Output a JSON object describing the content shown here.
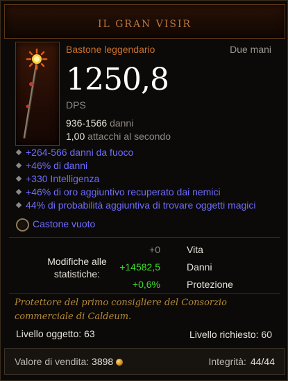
{
  "item": {
    "name": "IL GRAN VISIR",
    "type": "Bastone leggendario",
    "slot": "Due mani",
    "dps_value": "1250,8",
    "dps_label": "DPS",
    "damage_range": "936-1566",
    "damage_label": "danni",
    "attack_speed": "1,00",
    "attack_speed_label": "attacchi al secondo",
    "affixes": [
      "+264-566 danni da fuoco",
      "+46% di danni",
      "+330 Intelligenza",
      "+46% di oro aggiuntivo recuperato dai nemici",
      "44% di probabilità aggiuntiva di trovare oggetti magici"
    ],
    "socket_label": "Castone vuoto",
    "stat_changes": {
      "label": "Modifiche alle statistiche:",
      "rows": [
        {
          "value": "+0",
          "name": "Vita",
          "tone": "neutral"
        },
        {
          "value": "+14582,5",
          "name": "Danni",
          "tone": "pos"
        },
        {
          "value": "+0,6%",
          "name": "Protezione",
          "tone": "pos"
        }
      ]
    },
    "flavor_text": "Protettore del primo consigliere del Consorzio commerciale di Caldeum.",
    "item_level": "Livello oggetto: 63",
    "required_level": "Livello richiesto: 60",
    "sell_label": "Valore di vendita:",
    "sell_value": "3898",
    "durability_label": "Integrità:",
    "durability_value": "44/44"
  },
  "colors": {
    "legendary": "#c8702c",
    "magic_affix": "#6e6cff",
    "positive_stat": "#3fdc2e",
    "flavor": "#b78a36"
  },
  "icons": [
    "staff-icon",
    "socket-icon",
    "gold-coin-icon",
    "affix-bullet-icon"
  ]
}
